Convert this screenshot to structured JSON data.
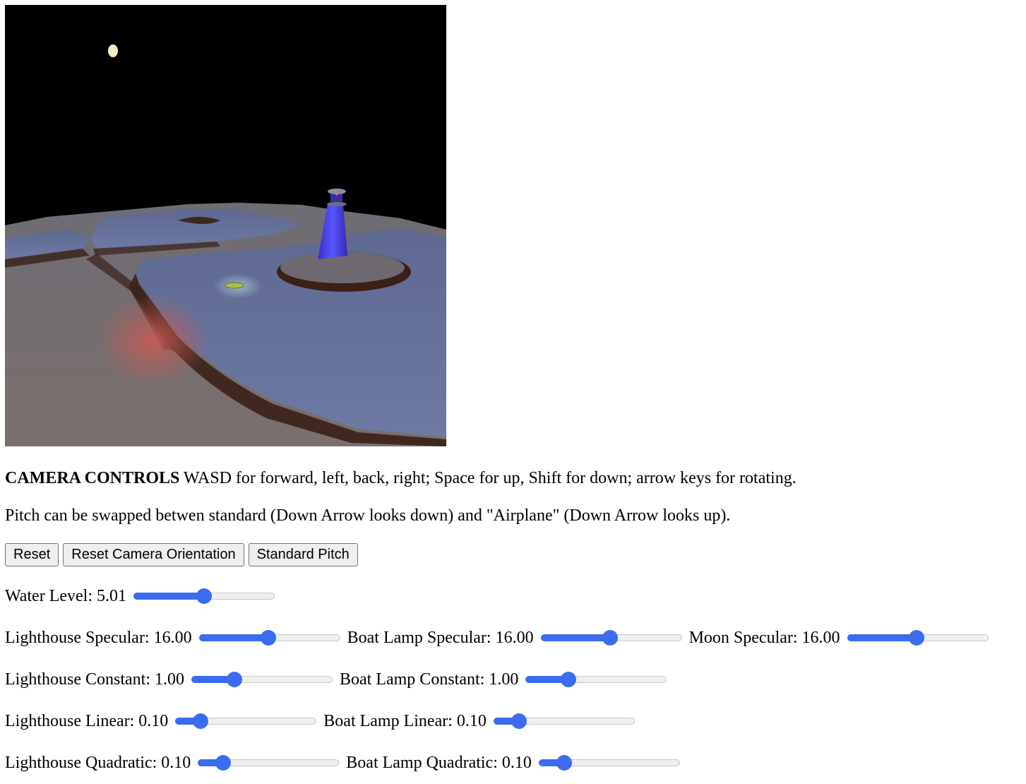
{
  "canvas": {
    "scene": "webgl-viewport"
  },
  "instructions": {
    "heading": "CAMERA CONTROLS",
    "camera_text": " WASD for forward, left, back, right; Space for up, Shift for down; arrow keys for rotating.",
    "pitch_text": "Pitch can be swapped betwen standard (Down Arrow looks down) and \"Airplane\" (Down Arrow looks up)."
  },
  "buttons": {
    "reset": "Reset",
    "reset_camera": "Reset Camera Orientation",
    "pitch": "Standard Pitch"
  },
  "controls": {
    "water_level": {
      "label": "Water Level: 5.01",
      "fraction": 0.5
    },
    "lighthouse_specular": {
      "label": "Lighthouse Specular: 16.00",
      "fraction": 0.49
    },
    "boat_specular": {
      "label": "Boat Lamp Specular: 16.00",
      "fraction": 0.49
    },
    "moon_specular": {
      "label": "Moon Specular: 16.00",
      "fraction": 0.49
    },
    "lighthouse_constant": {
      "label": "Lighthouse Constant: 1.00",
      "fraction": 0.28
    },
    "boat_constant": {
      "label": "Boat Lamp Constant: 1.00",
      "fraction": 0.28
    },
    "lighthouse_linear": {
      "label": "Lighthouse Linear: 0.10",
      "fraction": 0.14
    },
    "boat_linear": {
      "label": "Boat Lamp Linear: 0.10",
      "fraction": 0.14
    },
    "lighthouse_quadratic": {
      "label": "Lighthouse Quadratic: 0.10",
      "fraction": 0.14
    },
    "boat_quadratic": {
      "label": "Boat Lamp Quadratic: 0.10",
      "fraction": 0.14
    }
  },
  "colors": {
    "slider_accent": "#3b6cf0",
    "slider_track": "#efefef"
  }
}
